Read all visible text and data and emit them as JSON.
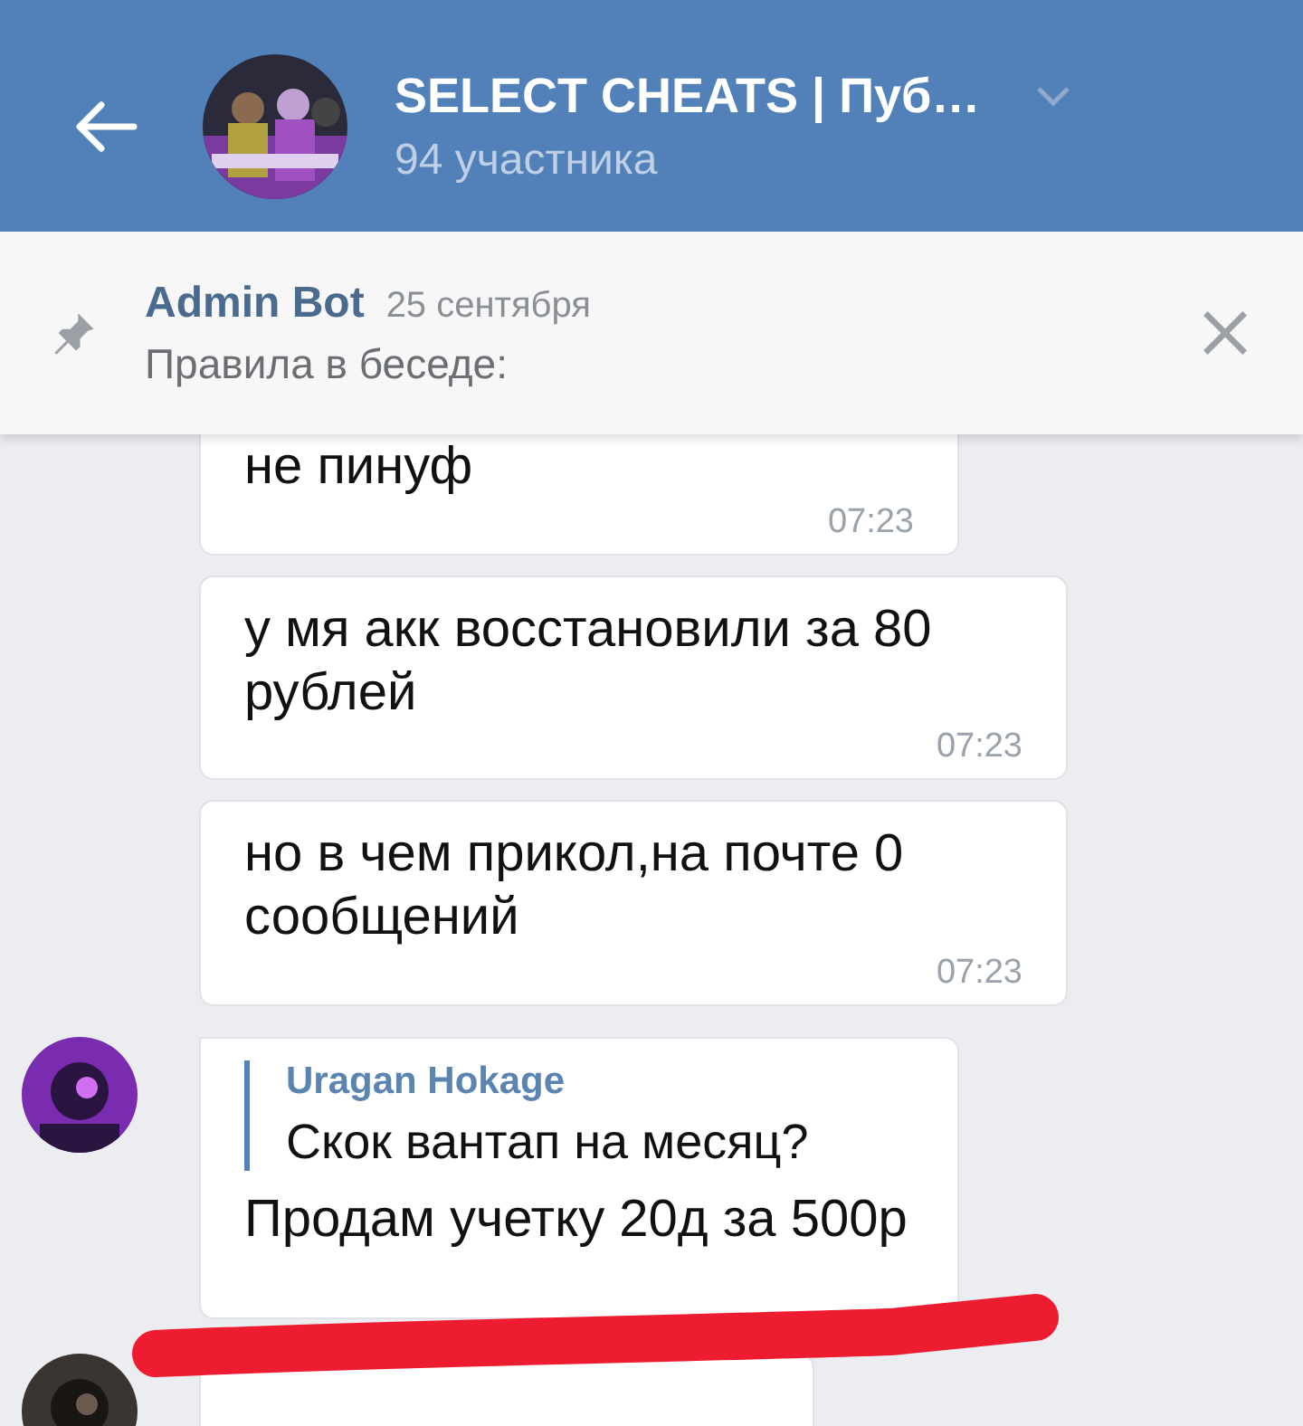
{
  "header": {
    "title": "SELECT CHEATS | Пуб…",
    "subtitle": "94 участника"
  },
  "pinned": {
    "author": "Admin Bot",
    "date": "25 сентября",
    "text": "Правила в беседе:"
  },
  "messages": [
    {
      "kind": "text",
      "show_avatar": false,
      "text": "не пинуф",
      "time": "07:23"
    },
    {
      "kind": "text",
      "show_avatar": false,
      "text": "у мя акк восстановили за 80 рублей",
      "time": "07:23"
    },
    {
      "kind": "text",
      "show_avatar": false,
      "text": "но в чем прикол,на почте 0 сообщений",
      "time": "07:23"
    },
    {
      "kind": "reply",
      "show_avatar": true,
      "reply": {
        "author": "Uragan Hokage",
        "text": "Скок вантап на месяц?"
      },
      "text": "Продам учетку 20д за 500р"
    },
    {
      "kind": "cut",
      "show_avatar": true
    }
  ]
}
